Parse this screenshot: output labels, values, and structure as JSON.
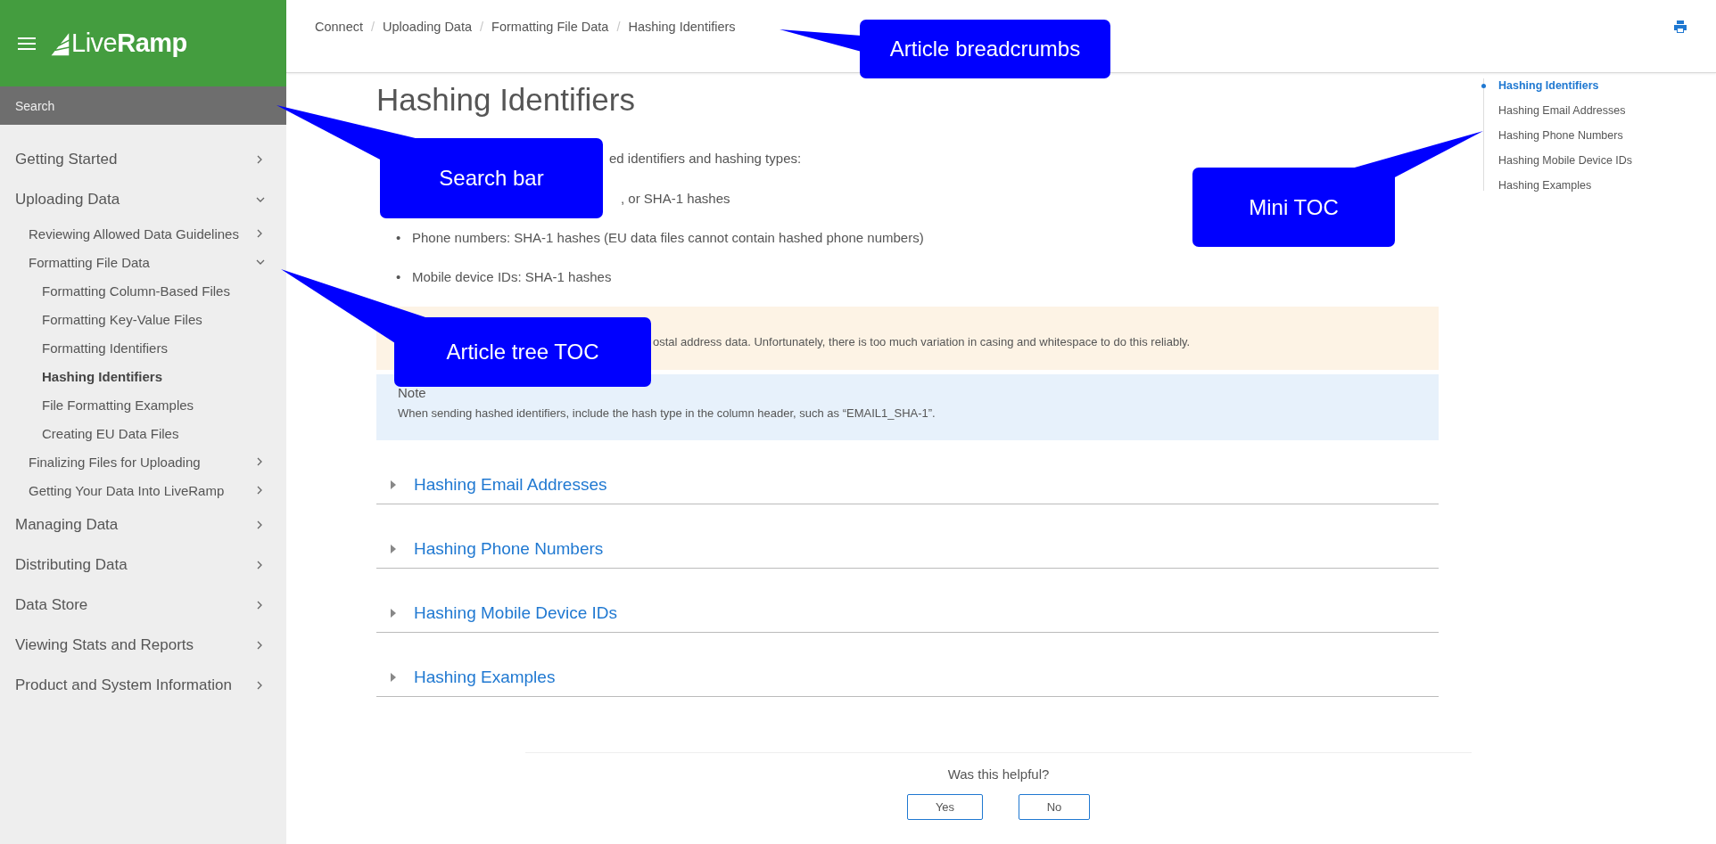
{
  "header": {
    "logo": "Live**Ramp**"
  },
  "search": {
    "placeholder": "Search"
  },
  "nav": [
    {
      "label": "Getting Started",
      "expanded": false,
      "selected": false
    },
    {
      "label": "Uploading Data",
      "expanded": true,
      "selected": false,
      "children": [
        {
          "label": "Reviewing Allowed Data Guidelines",
          "expanded": false,
          "selected": false
        },
        {
          "label": "Formatting File Data",
          "expanded": true,
          "selected": false,
          "children": [
            {
              "label": "Formatting Column-Based Files",
              "selected": false
            },
            {
              "label": "Formatting Key-Value Files",
              "selected": false
            },
            {
              "label": "Formatting Identifiers",
              "selected": false
            },
            {
              "label": "Hashing Identifiers",
              "selected": true
            },
            {
              "label": "File Formatting Examples",
              "selected": false
            },
            {
              "label": "Creating EU Data Files",
              "selected": false
            }
          ]
        },
        {
          "label": "Finalizing Files for Uploading",
          "expanded": false,
          "selected": false
        },
        {
          "label": "Getting Your Data Into LiveRamp",
          "expanded": false,
          "selected": false
        }
      ]
    },
    {
      "label": "Managing Data",
      "expanded": false,
      "selected": false
    },
    {
      "label": "Distributing Data",
      "expanded": false,
      "selected": false
    },
    {
      "label": "Data Store",
      "expanded": false,
      "selected": false
    },
    {
      "label": "Viewing Stats and Reports",
      "expanded": false,
      "selected": false
    },
    {
      "label": "Product and System Information",
      "expanded": false,
      "selected": false
    }
  ],
  "breadcrumbs": {
    "separator": "/",
    "items": [
      "Connect",
      "Uploading Data",
      "Formatting File Data",
      "Hashing Identifiers"
    ]
  },
  "article": {
    "title": "Hashing Identifiers",
    "intro": "ed identifiers and hashing types:",
    "bullets": [
      {
        "kind": "partial",
        "text": ", or SHA-1 hashes"
      },
      {
        "kind": "bullet",
        "marker": "•",
        "text": "Phone numbers: SHA-1 hashes (EU data files cannot contain hashed phone numbers)"
      },
      {
        "kind": "bullet",
        "marker": "•",
        "text": "Mobile device IDs: SHA-1 hashes"
      }
    ],
    "warning": {
      "text": "ostal address data. Unfortunately, there is too much variation in casing and whitespace to do this reliably."
    },
    "note": {
      "title": "Note",
      "text": "When sending hashed identifiers, include the hash type in the column header, such as “EMAIL1_SHA-1”."
    },
    "sections": [
      {
        "title": "Hashing Email Addresses",
        "expanded": false
      },
      {
        "title": "Hashing Phone Numbers",
        "expanded": false
      },
      {
        "title": "Hashing Mobile Device IDs",
        "expanded": false
      },
      {
        "title": "Hashing Examples",
        "expanded": false
      }
    ],
    "feedback": {
      "question": "Was this helpful?",
      "buttons": [
        "Yes",
        "No"
      ]
    }
  },
  "mini_toc": [
    {
      "label": "Hashing Identifiers",
      "selected": true
    },
    {
      "label": "Hashing Email Addresses",
      "selected": false
    },
    {
      "label": "Hashing Phone Numbers",
      "selected": false
    },
    {
      "label": "Hashing Mobile Device IDs",
      "selected": false
    },
    {
      "label": "Hashing Examples",
      "selected": false
    }
  ],
  "annotations": [
    {
      "label": "Article breadcrumbs"
    },
    {
      "label": "Search bar"
    },
    {
      "label": "Mini TOC"
    },
    {
      "label": "Article tree TOC"
    }
  ]
}
